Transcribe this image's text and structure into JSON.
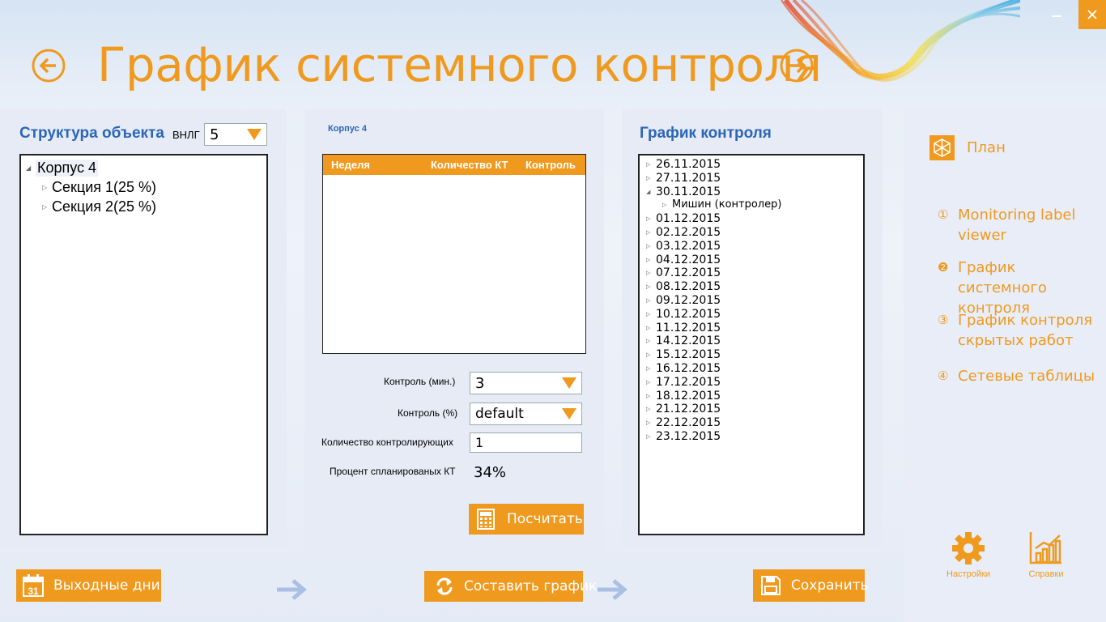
{
  "header": {
    "title": "График системного контроля"
  },
  "structure": {
    "title": "Структура объекта",
    "vnlg_label": "ВНЛГ",
    "vnlg_value": "5",
    "tree": [
      {
        "label": "Корпус 4"
      },
      {
        "label": "Секция 1(25 %)"
      },
      {
        "label": "Секция 2(25 %)"
      }
    ]
  },
  "middle": {
    "caption": "Корпус 4",
    "columns": [
      "Неделя",
      "Количество КТ",
      "Контроль"
    ],
    "control_min_label": "Контроль (мин.)",
    "control_min_value": "3",
    "control_pct_label": "Контроль (%)",
    "control_pct_value": "default",
    "controllers_label": "Количество контролирующих",
    "controllers_value": "1",
    "planned_pct_label": "Процент спланированых КТ",
    "planned_pct_value": "34%",
    "calc_button": "Посчитать"
  },
  "schedule": {
    "title": "График контроля",
    "dates": [
      {
        "label": "26.11.2015",
        "expanded": false
      },
      {
        "label": "27.11.2015",
        "expanded": false
      },
      {
        "label": "30.11.2015",
        "expanded": true,
        "child": "Мишин (контролер)"
      },
      {
        "label": "01.12.2015",
        "expanded": false
      },
      {
        "label": "02.12.2015",
        "expanded": false
      },
      {
        "label": "03.12.2015",
        "expanded": false
      },
      {
        "label": "04.12.2015",
        "expanded": false
      },
      {
        "label": "07.12.2015",
        "expanded": false
      },
      {
        "label": "08.12.2015",
        "expanded": false
      },
      {
        "label": "09.12.2015",
        "expanded": false
      },
      {
        "label": "10.12.2015",
        "expanded": false
      },
      {
        "label": "11.12.2015",
        "expanded": false
      },
      {
        "label": "14.12.2015",
        "expanded": false
      },
      {
        "label": "15.12.2015",
        "expanded": false
      },
      {
        "label": "16.12.2015",
        "expanded": false
      },
      {
        "label": "17.12.2015",
        "expanded": false
      },
      {
        "label": "18.12.2015",
        "expanded": false
      },
      {
        "label": "21.12.2015",
        "expanded": false
      },
      {
        "label": "22.12.2015",
        "expanded": false
      },
      {
        "label": "23.12.2015",
        "expanded": false
      }
    ]
  },
  "sidebar": {
    "plan_label": "План",
    "items": [
      {
        "num": "①",
        "line1": "Monitoring label",
        "line2": " viewer"
      },
      {
        "num": "❷",
        "line1": "График системного",
        "line2": "контроля"
      },
      {
        "num": "③",
        "line1": "График контроля",
        "line2": "скрытых работ"
      },
      {
        "num": "④",
        "line1": "Сетевые таблицы",
        "line2": ""
      }
    ],
    "settings_label": "Настройки",
    "help_label": "Справки"
  },
  "footer": {
    "holidays_button": "Выходные дни",
    "compose_button": "Составить график",
    "save_button": "Сохранить",
    "calendar_day": "31"
  },
  "colors": {
    "accent": "#ef9a1f",
    "title_blue": "#2a66b5",
    "panel": "#e6ebf6"
  }
}
